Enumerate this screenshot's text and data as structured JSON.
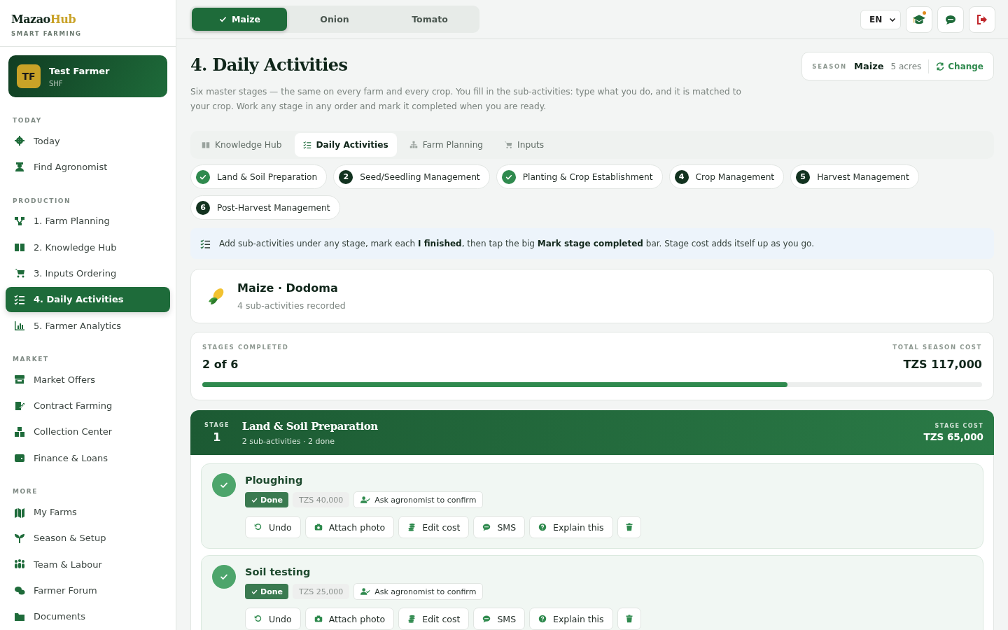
{
  "brand": {
    "name_a": "Mazao",
    "name_b": "Hub",
    "tagline": "SMART FARMING"
  },
  "user": {
    "initials": "TF",
    "name": "Test Farmer",
    "role": "SHF"
  },
  "sidebar": {
    "sections": [
      {
        "title": "TODAY",
        "items": [
          {
            "label": "Today",
            "selected": false
          },
          {
            "label": "Find Agronomist",
            "selected": false
          }
        ]
      },
      {
        "title": "PRODUCTION",
        "items": [
          {
            "label": "1. Farm Planning",
            "selected": false
          },
          {
            "label": "2. Knowledge Hub",
            "selected": false
          },
          {
            "label": "3. Inputs Ordering",
            "selected": false
          },
          {
            "label": "4. Daily Activities",
            "selected": true
          },
          {
            "label": "5. Farmer Analytics",
            "selected": false
          }
        ]
      },
      {
        "title": "MARKET",
        "items": [
          {
            "label": "Market Offers",
            "selected": false
          },
          {
            "label": "Contract Farming",
            "selected": false
          },
          {
            "label": "Collection Center",
            "selected": false
          },
          {
            "label": "Finance & Loans",
            "selected": false
          }
        ]
      },
      {
        "title": "MORE",
        "items": [
          {
            "label": "My Farms",
            "selected": false
          },
          {
            "label": "Season & Setup",
            "selected": false
          },
          {
            "label": "Team & Labour",
            "selected": false
          },
          {
            "label": "Farmer Forum",
            "selected": false
          },
          {
            "label": "Documents",
            "selected": false
          }
        ]
      }
    ]
  },
  "crop_tabs": [
    {
      "label": "Maize",
      "selected": true
    },
    {
      "label": "Onion",
      "selected": false
    },
    {
      "label": "Tomato",
      "selected": false
    }
  ],
  "language": "EN",
  "page": {
    "title": "4. Daily Activities",
    "description": "Six master stages — the same on every farm and every crop. You fill in the sub-activities: type what you do, and it is matched to your crop. Work any stage in any order and mark it completed when you are ready."
  },
  "season": {
    "label": "SEASON",
    "crop": "Maize",
    "area": "5 acres",
    "action": "Change"
  },
  "sub_tabs": [
    {
      "label": "Knowledge Hub",
      "selected": false
    },
    {
      "label": "Daily Activities",
      "selected": true
    },
    {
      "label": "Farm Planning",
      "selected": false
    },
    {
      "label": "Inputs",
      "selected": false
    }
  ],
  "stages": [
    {
      "label": "Land & Soil Preparation",
      "done": true
    },
    {
      "label": "Seed/Seedling Management",
      "done": false,
      "number": "2"
    },
    {
      "label": "Planting & Crop Establishment",
      "done": true
    },
    {
      "label": "Crop Management",
      "done": false,
      "number": "4"
    },
    {
      "label": "Harvest Management",
      "done": false,
      "number": "5"
    },
    {
      "label": "Post-Harvest Management",
      "done": false,
      "number": "6"
    }
  ],
  "hint": "Add sub-activities under any stage, mark each **I finished**, then tap the big **Mark stage completed** bar. Stage cost adds itself up as you go.",
  "farm": {
    "title": "Maize · Dodoma",
    "subtitle": "4 sub-activities recorded"
  },
  "progress": {
    "label": "STAGES COMPLETED",
    "value": "2 of 6",
    "cost_label": "TOTAL SEASON COST",
    "cost": "TZS 117,000",
    "level": 0.75
  },
  "stage": {
    "label": "STAGE",
    "number": "1",
    "title": "Land & Soil Preparation",
    "subtitle": "2 sub-activities · 2 done",
    "cost_label": "STAGE COST",
    "cost": "TZS 65,000"
  },
  "activities": [
    {
      "title": "Ploughing",
      "done": true,
      "status": "Done",
      "cost": "TZS 40,000",
      "confirm": "Ask agronomist to confirm",
      "actions": [
        "Undo",
        "Attach photo",
        "Edit cost",
        "SMS",
        "Explain this"
      ]
    },
    {
      "title": "Soil testing",
      "done": true,
      "status": "Done",
      "cost": "TZS 25,000",
      "confirm": "Ask agronomist to confirm",
      "actions": [
        "Undo",
        "Attach photo",
        "Edit cost",
        "SMS",
        "Explain this"
      ]
    }
  ]
}
